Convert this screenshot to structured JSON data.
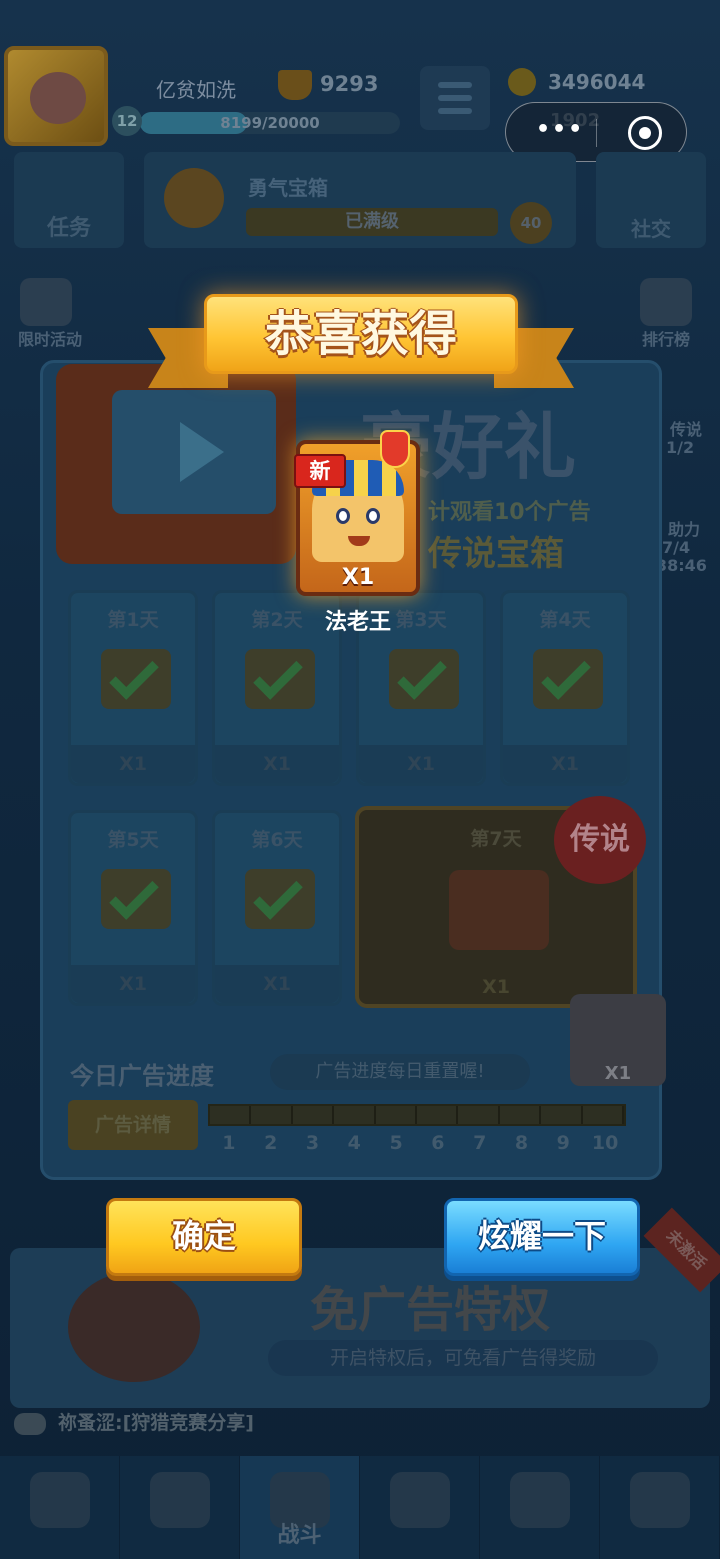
{
  "player": {
    "name": "亿贫如洗",
    "level": "12",
    "xp_text": "8199/20000",
    "xp_fraction": 0.41,
    "trophies": "9293",
    "coins": "3496044",
    "gems": "1902"
  },
  "top_nav": {
    "task_label": "任务",
    "chest_title": "勇气宝箱",
    "chest_status": "已满级",
    "chest_level": "40",
    "social_label": "社交"
  },
  "side": {
    "limited_event": "限时活动",
    "rank": "排行榜",
    "legend_progress": "传说",
    "legend_count": "1/2",
    "help": "助力",
    "help_count": "7/4",
    "timer": "38:46"
  },
  "event": {
    "bg_title": "豪好礼",
    "bg_sub1": "计观看10个广告",
    "bg_sub2": "传说宝箱",
    "days": [
      {
        "label": "第1天",
        "reward": "X1"
      },
      {
        "label": "第2天",
        "reward": "X1"
      },
      {
        "label": "第3天",
        "reward": "X1"
      },
      {
        "label": "第4天",
        "reward": "X1"
      },
      {
        "label": "第5天",
        "reward": "X1"
      },
      {
        "label": "第6天",
        "reward": "X1"
      }
    ],
    "day7": {
      "label": "第7天",
      "reward": "X1"
    },
    "legend_badge": "传说",
    "side_chest_reward": "X1",
    "progress_title": "今日广告进度",
    "progress_note": "广告进度每日重置喔!",
    "detail_button": "广告详情",
    "progress_numbers": [
      "1",
      "2",
      "3",
      "4",
      "5",
      "6",
      "7",
      "8",
      "9",
      "10"
    ]
  },
  "privilege": {
    "title": "免广告特权",
    "description": "开启特权后，可免看广告得奖励",
    "tag": "未激活"
  },
  "chat": {
    "message": "祢蚤涩:[狩猎竞赛分享]"
  },
  "bottom_nav": {
    "items": [
      "",
      "",
      "战斗",
      "",
      "",
      ""
    ]
  },
  "modal": {
    "title": "恭喜获得",
    "reward_name": "法老王",
    "reward_count": "X1",
    "new_tag": "新",
    "confirm_label": "确定",
    "show_off_label": "炫耀一下"
  },
  "colors": {
    "confirm_button": "#ffc820",
    "show_button": "#2fa6f2",
    "banner": "#ffc534"
  }
}
